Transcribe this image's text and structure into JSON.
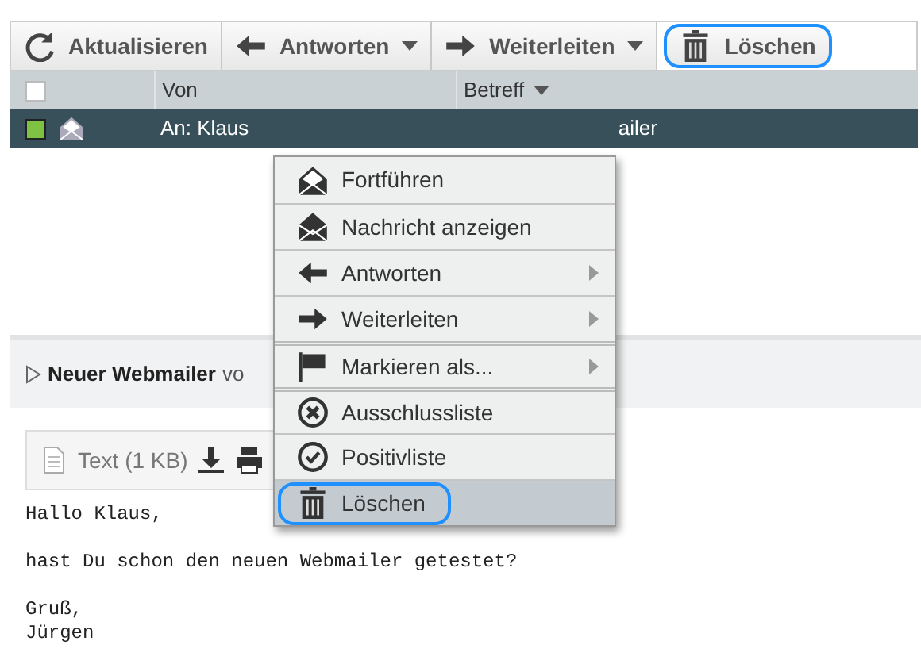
{
  "toolbar": [
    {
      "kind": "refresh",
      "label": "Aktualisieren",
      "dropdown": false,
      "focused": false
    },
    {
      "kind": "arrow-left",
      "label": "Antworten",
      "dropdown": true,
      "focused": false
    },
    {
      "kind": "arrow-right",
      "label": "Weiterleiten",
      "dropdown": true,
      "focused": false
    },
    {
      "kind": "trash",
      "label": "Löschen",
      "dropdown": false,
      "focused": true
    }
  ],
  "list": {
    "select_all": {
      "checked": false
    },
    "columns": [
      {
        "label": "Von",
        "sortable": false
      },
      {
        "label": "Betreff",
        "sortable": true
      }
    ],
    "rows": [
      {
        "checked": true,
        "selected": true,
        "from": "An: Klaus",
        "subject": "ailer"
      }
    ]
  },
  "context_menu": [
    {
      "kind": "envelope-open",
      "label": "Fortführen",
      "submenu": false,
      "selected": false,
      "group_start": false
    },
    {
      "kind": "envelope",
      "label": "Nachricht anzeigen",
      "submenu": false,
      "selected": false,
      "group_start": false
    },
    {
      "kind": "arrow-left",
      "label": "Antworten",
      "submenu": true,
      "selected": false,
      "group_start": false
    },
    {
      "kind": "arrow-right",
      "label": "Weiterleiten",
      "submenu": true,
      "selected": false,
      "group_start": false
    },
    {
      "kind": "flag",
      "label": "Markieren als...",
      "submenu": true,
      "selected": false,
      "group_start": true
    },
    {
      "kind": "x-circle",
      "label": "Ausschlussliste",
      "submenu": false,
      "selected": false,
      "group_start": true
    },
    {
      "kind": "check-circle",
      "label": "Positivliste",
      "submenu": false,
      "selected": false,
      "group_start": false
    },
    {
      "kind": "trash",
      "label": "Löschen",
      "submenu": false,
      "selected": true,
      "group_start": false
    }
  ],
  "preview": {
    "subject": "Neuer Webmailer",
    "from_prefix": "vo",
    "attachment": "Text (1 KB)",
    "body": [
      [
        "Hallo Klaus,"
      ],
      [
        "hast Du schon den neuen Webmailer getestet?"
      ],
      [
        "Gruß,",
        "Jürgen"
      ]
    ]
  }
}
